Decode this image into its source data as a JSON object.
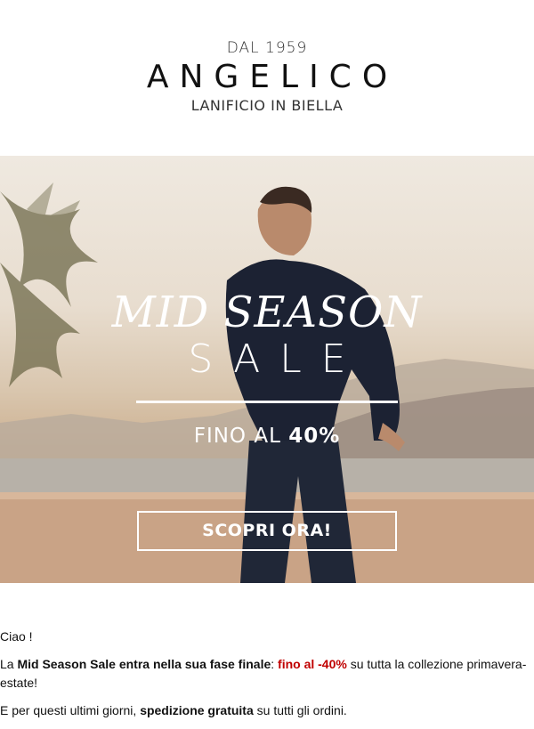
{
  "header": {
    "since": "DAL 1959",
    "brand": "ANGELICO",
    "tagline": "LANIFICIO IN BIELLA"
  },
  "hero": {
    "title": "MID SEASON",
    "subtitle": "SALE",
    "offer_prefix": "FINO AL",
    "offer_value": "40%",
    "cta_label": "SCOPRI ORA!"
  },
  "body": {
    "greeting": "Ciao !",
    "p1_a": "La ",
    "p1_b": "Mid Season Sale entra nella sua fase finale",
    "p1_c": ": ",
    "p1_d": "fino al -40%",
    "p1_e": " su tutta la collezione primavera-estate!",
    "p2_a": "E per questi ultimi giorni, ",
    "p2_b": "spedizione gratuita",
    "p2_c": " su tutti gli ordini."
  },
  "colors": {
    "accent_red": "#c00000",
    "text": "#111111"
  }
}
